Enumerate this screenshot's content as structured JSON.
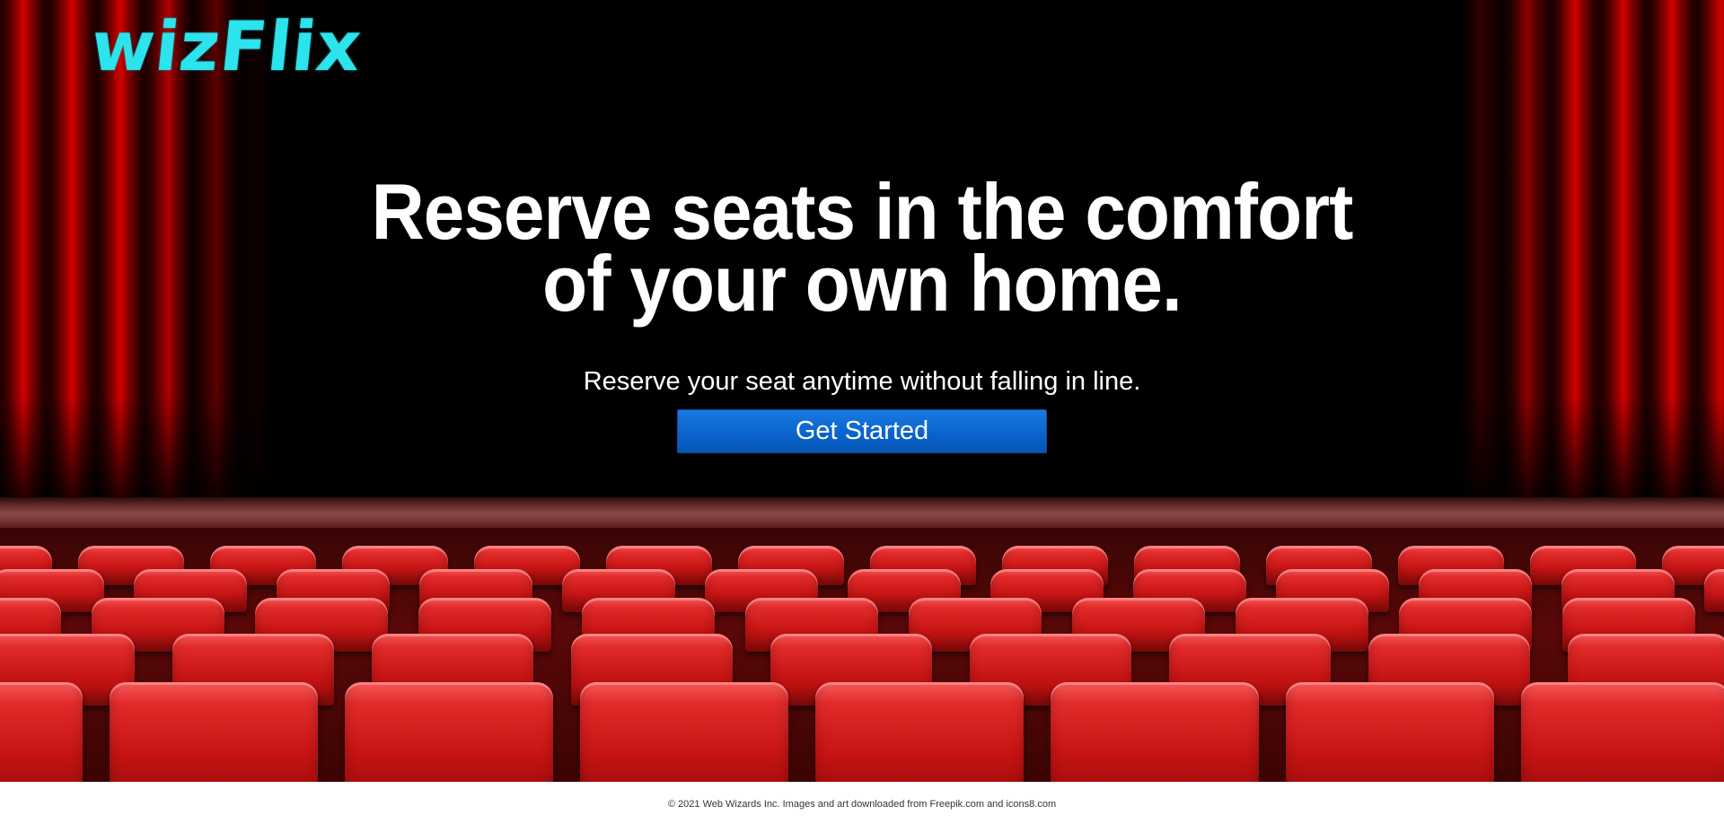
{
  "brand": {
    "logo_text": "wizFlix",
    "logo_color": "#2de3ec"
  },
  "hero": {
    "headline_line1": "Reserve seats in the comfort",
    "headline_line2": "of your own home.",
    "subtitle": "Reserve your seat anytime without falling in line.",
    "cta_label": "Get Started",
    "cta_color": "#0a64cc",
    "background_color": "#000000",
    "curtain_color": "#c00000",
    "seat_color": "#d41a1a"
  },
  "footer": {
    "text": "© 2021 Web Wizards Inc. Images and art downloaded from Freepik.com and icons8.com"
  }
}
